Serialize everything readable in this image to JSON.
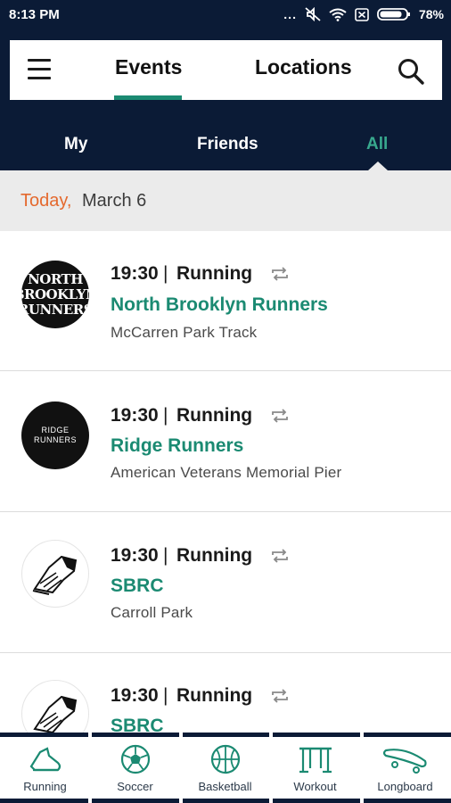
{
  "status_bar": {
    "time": "8:13 PM",
    "dots": "...",
    "battery": "78%"
  },
  "header": {
    "tabs": [
      {
        "label": "Events"
      },
      {
        "label": "Locations"
      }
    ]
  },
  "subtabs": [
    {
      "label": "My"
    },
    {
      "label": "Friends"
    },
    {
      "label": "All"
    }
  ],
  "date_band": {
    "today": "Today,",
    "date": "March 6"
  },
  "events": [
    {
      "time": "19:30",
      "separator": "|",
      "sport": "Running",
      "name": "North Brooklyn Runners",
      "place": "McCarren Park Track",
      "avatar_lines": [
        "NORTH",
        "BROOKLYN",
        "RUNNERS"
      ]
    },
    {
      "time": "19:30",
      "separator": "|",
      "sport": "Running",
      "name": "Ridge Runners",
      "place": "American Veterans Memorial Pier",
      "avatar_lines": [
        "RIDGE",
        "RUNNERS"
      ]
    },
    {
      "time": "19:30",
      "separator": "|",
      "sport": "Running",
      "name": "SBRC",
      "place": "Carroll Park"
    },
    {
      "time": "19:30",
      "separator": "|",
      "sport": "Running",
      "name": "SBRC"
    }
  ],
  "bottom_nav": [
    {
      "label": "Running",
      "icon": "running-shoe-icon"
    },
    {
      "label": "Soccer",
      "icon": "soccer-ball-icon"
    },
    {
      "label": "Basketball",
      "icon": "basketball-icon"
    },
    {
      "label": "Workout",
      "icon": "workout-bars-icon"
    },
    {
      "label": "Longboard",
      "icon": "longboard-icon"
    }
  ],
  "colors": {
    "header_bg": "#0b1b36",
    "accent": "#1b8a72",
    "today": "#e4692e",
    "date_band": "#ebebeb"
  }
}
